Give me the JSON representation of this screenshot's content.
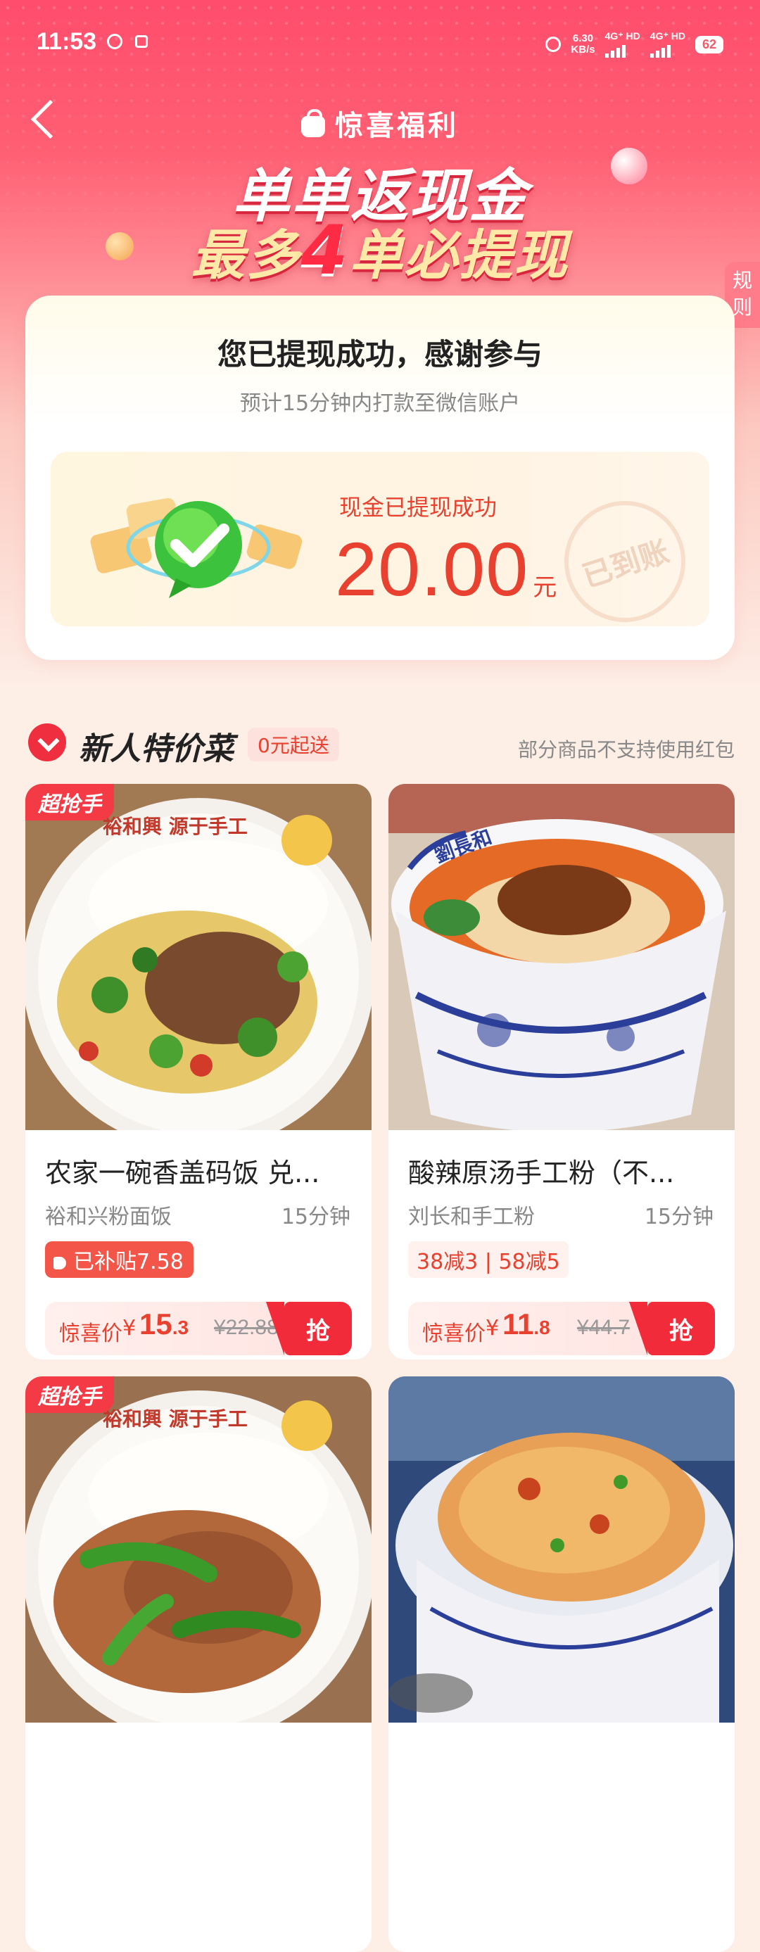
{
  "status_bar": {
    "time": "11:53",
    "net_speed": "6.30",
    "net_unit": "KB/s",
    "sig1": "4G⁺ HD",
    "sig2": "4G⁺ HD",
    "battery": "62"
  },
  "nav": {
    "title": "惊喜福利"
  },
  "banner": {
    "line1": "单单返现金",
    "line2_pre": "最多",
    "line2_num": "4",
    "line2_post": "单必提现"
  },
  "rules_tab": "规则",
  "success": {
    "title": "您已提现成功，感谢参与",
    "subtitle": "预计15分钟内打款至微信账户",
    "cash_label": "现金已提现成功",
    "amount": "20.00",
    "unit": "元",
    "stamp": "已到账"
  },
  "section": {
    "title": "新人特价菜",
    "chip": "0元起送",
    "note": "部分商品不支持使用红包"
  },
  "products": [
    {
      "tag": "超抢手",
      "name": "农家一碗香盖码饭 兑...",
      "shop": "裕和兴粉面饭",
      "eta": "15分钟",
      "subsidy": "已补贴7.58",
      "price_label": "惊喜价",
      "currency": "¥",
      "price_int": "15",
      "price_dec": ".3",
      "orig_price": "¥22.88",
      "grab": "抢",
      "bowl_text": "裕和興  源于手工"
    },
    {
      "tag": "",
      "name": "酸辣原汤手工粉（不...",
      "shop": "刘长和手工粉",
      "eta": "15分钟",
      "promos": "38减3 | 58减5",
      "price_label": "惊喜价",
      "currency": "¥",
      "price_int": "11",
      "price_dec": ".8",
      "orig_price": "¥44.7",
      "grab": "抢",
      "bowl_text": "劉長和"
    },
    {
      "tag": "超抢手",
      "bowl_text": "裕和興  源于手工"
    },
    {
      "tag": ""
    }
  ],
  "colors": {
    "accent": "#e8412f",
    "grab_red": "#f22b3b",
    "hero_top": "#ff4d6d"
  }
}
